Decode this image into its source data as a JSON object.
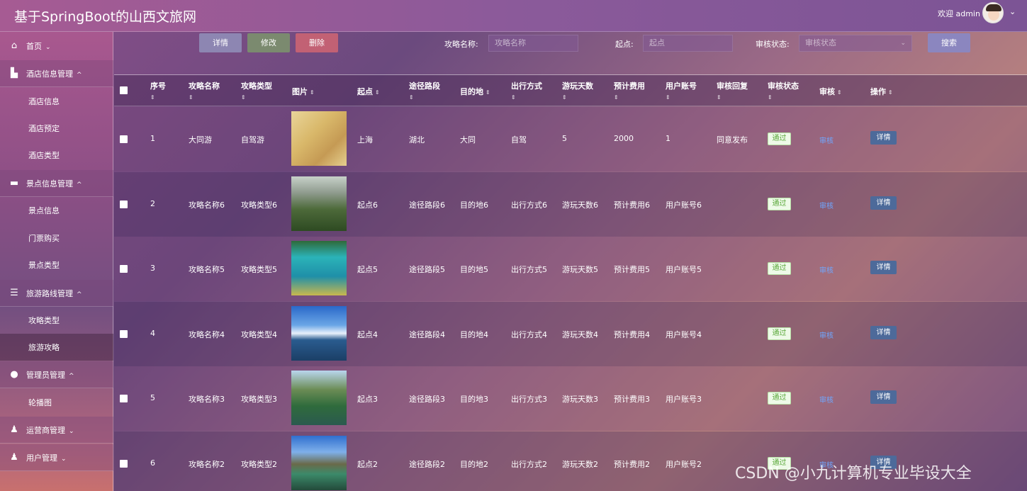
{
  "app": {
    "title": "基于SpringBoot的山西文旅网"
  },
  "header": {
    "welcome": "欢迎 admin",
    "caret": "⌄"
  },
  "sidebar": {
    "items": [
      {
        "label": "首页",
        "caret": "⌄",
        "icon": "home-icon"
      },
      {
        "label": "酒店信息管理",
        "caret": "^",
        "icon": "hotel-icon"
      },
      {
        "label": "酒店信息"
      },
      {
        "label": "酒店预定"
      },
      {
        "label": "酒店类型"
      },
      {
        "label": "景点信息管理",
        "caret": "^",
        "icon": "scenic-icon"
      },
      {
        "label": "景点信息"
      },
      {
        "label": "门票购买"
      },
      {
        "label": "景点类型"
      },
      {
        "label": "旅游路线管理",
        "caret": "^",
        "icon": "route-icon"
      },
      {
        "label": "攻略类型"
      },
      {
        "label": "旅游攻略"
      },
      {
        "label": "管理员管理",
        "caret": "^",
        "icon": "admin-icon"
      },
      {
        "label": "轮播图"
      },
      {
        "label": "运营商管理",
        "caret": "⌄",
        "icon": "operator-icon"
      },
      {
        "label": "用户管理",
        "caret": "⌄",
        "icon": "user-icon"
      }
    ]
  },
  "toolbar": {
    "detail_label": "详情",
    "edit_label": "修改",
    "delete_label": "删除",
    "search_label": "搜索",
    "filters": {
      "name_label": "攻略名称:",
      "name_placeholder": "攻略名称",
      "start_label": "起点:",
      "start_placeholder": "起点",
      "status_label": "审核状态:",
      "status_placeholder": "审核状态"
    }
  },
  "table": {
    "headers": [
      "序号",
      "攻略名称",
      "攻略类型",
      "图片",
      "起点",
      "途径路段",
      "目的地",
      "出行方式",
      "游玩天数",
      "预计费用",
      "用户账号",
      "审核回复",
      "审核状态",
      "审核",
      "操作"
    ],
    "sort_glyph": "⇕",
    "rows": [
      {
        "no": "1",
        "name": "大同游",
        "type": "自驾游",
        "start": "上海",
        "via": "湖北",
        "dest": "大同",
        "mode": "自驾",
        "days": "5",
        "cost": "2000",
        "account": "1",
        "reply": "同意发布",
        "status": "通过",
        "audit": "审核",
        "action": "详情",
        "image": "map"
      },
      {
        "no": "2",
        "name": "攻略名称6",
        "type": "攻略类型6",
        "start": "起点6",
        "via": "途径路段6",
        "dest": "目的地6",
        "mode": "出行方式6",
        "days": "游玩天数6",
        "cost": "预计费用6",
        "account": "用户账号6",
        "reply": "",
        "status": "通过",
        "audit": "审核",
        "action": "详情",
        "image": "mountain"
      },
      {
        "no": "3",
        "name": "攻略名称5",
        "type": "攻略类型5",
        "start": "起点5",
        "via": "途径路段5",
        "dest": "目的地5",
        "mode": "出行方式5",
        "days": "游玩天数5",
        "cost": "预计费用5",
        "account": "用户账号5",
        "reply": "",
        "status": "通过",
        "audit": "审核",
        "action": "详情",
        "image": "lake"
      },
      {
        "no": "4",
        "name": "攻略名称4",
        "type": "攻略类型4",
        "start": "起点4",
        "via": "途径路段4",
        "dest": "目的地4",
        "mode": "出行方式4",
        "days": "游玩天数4",
        "cost": "预计费用4",
        "account": "用户账号4",
        "reply": "",
        "status": "通过",
        "audit": "审核",
        "action": "详情",
        "image": "sea"
      },
      {
        "no": "5",
        "name": "攻略名称3",
        "type": "攻略类型3",
        "start": "起点3",
        "via": "途径路段3",
        "dest": "目的地3",
        "mode": "出行方式3",
        "days": "游玩天数3",
        "cost": "预计费用3",
        "account": "用户账号3",
        "reply": "",
        "status": "通过",
        "audit": "审核",
        "action": "详情",
        "image": "river"
      },
      {
        "no": "6",
        "name": "攻略名称2",
        "type": "攻略类型2",
        "start": "起点2",
        "via": "途径路段2",
        "dest": "目的地2",
        "mode": "出行方式2",
        "days": "游玩天数2",
        "cost": "预计费用2",
        "account": "用户账号2",
        "reply": "",
        "status": "通过",
        "audit": "审核",
        "action": "详情",
        "image": "pavilion"
      }
    ]
  },
  "watermark": "CSDN @小九计算机专业毕设大全",
  "colors": {
    "accent": "#6fa7ff",
    "success": "#5aa83a",
    "detail_button": "#4d6a9a"
  }
}
